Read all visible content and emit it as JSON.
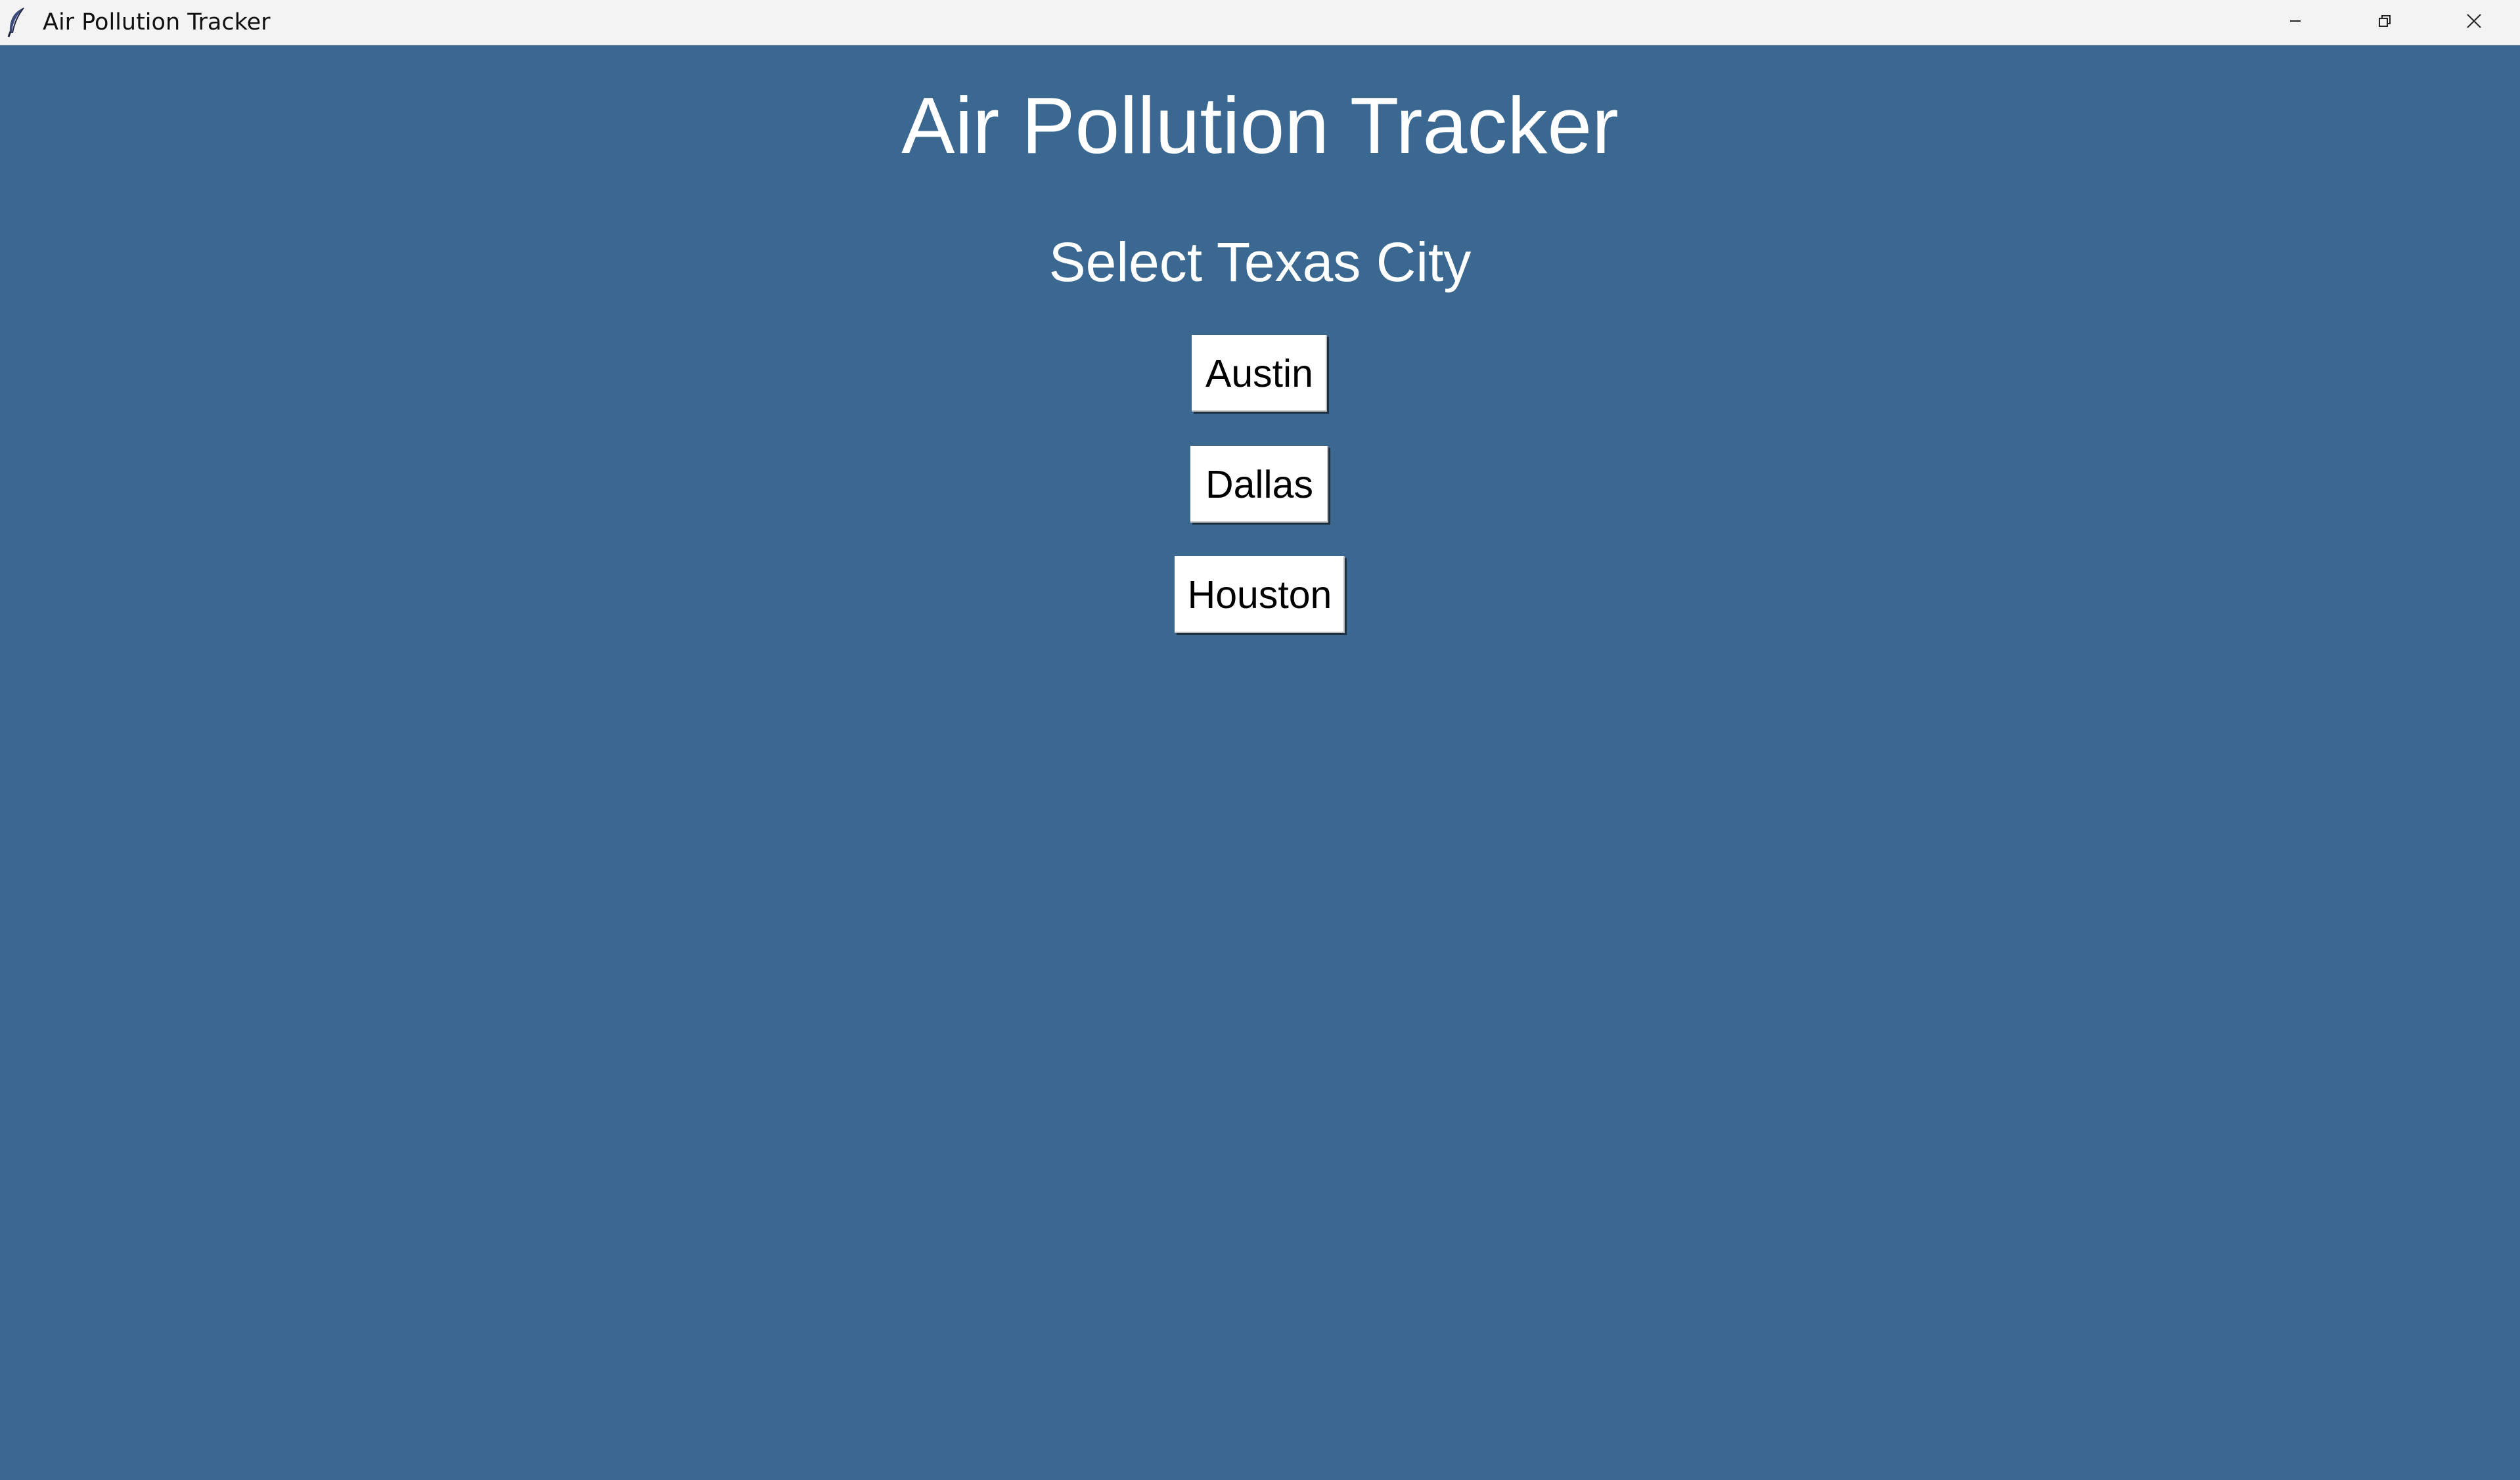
{
  "window": {
    "title": "Air Pollution Tracker",
    "icon": "feather-icon",
    "controls": {
      "minimize_icon": "minimize-icon",
      "maximize_icon": "restore-icon",
      "close_icon": "close-icon"
    }
  },
  "app": {
    "heading": "Air Pollution Tracker",
    "subheading": "Select Texas City",
    "cities": [
      {
        "label": "Austin"
      },
      {
        "label": "Dallas"
      },
      {
        "label": "Houston"
      }
    ]
  },
  "colors": {
    "background": "#3a6891",
    "titlebar": "#f3f3f3",
    "heading_text": "#ffffff",
    "button_bg": "#ffffff",
    "button_text": "#000000"
  }
}
